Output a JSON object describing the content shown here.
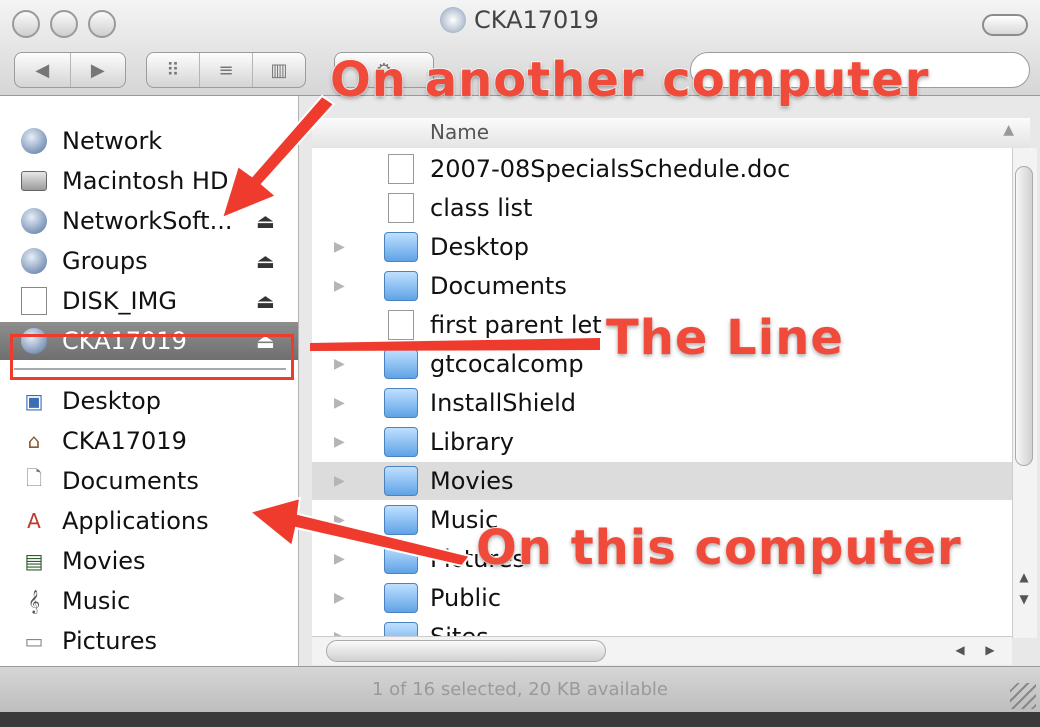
{
  "window": {
    "title": "CKA17019"
  },
  "toolbar": {
    "nav": {
      "back": "◀",
      "forward": "▶"
    },
    "views": {
      "icon": "⠿",
      "list": "≡",
      "column": "▥"
    }
  },
  "sidebar": {
    "items": [
      {
        "label": "Network",
        "icon": "network-globe-icon",
        "eject": ""
      },
      {
        "label": "Macintosh HD",
        "icon": "hard-drive-icon",
        "eject": ""
      },
      {
        "label": "NetworkSoft...",
        "icon": "network-volume-icon",
        "eject": "⏏"
      },
      {
        "label": "Groups",
        "icon": "network-volume-icon",
        "eject": "⏏"
      },
      {
        "label": "DISK_IMG",
        "icon": "disk-image-icon",
        "eject": "⏏"
      },
      {
        "label": "CKA17019",
        "icon": "network-volume-icon",
        "eject": "⏏"
      },
      {
        "label": "Desktop",
        "icon": "desktop-icon",
        "eject": ""
      },
      {
        "label": "CKA17019",
        "icon": "home-icon",
        "eject": ""
      },
      {
        "label": "Documents",
        "icon": "documents-icon",
        "eject": ""
      },
      {
        "label": "Applications",
        "icon": "applications-icon",
        "eject": ""
      },
      {
        "label": "Movies",
        "icon": "movies-icon",
        "eject": ""
      },
      {
        "label": "Music",
        "icon": "music-icon",
        "eject": ""
      },
      {
        "label": "Pictures",
        "icon": "pictures-icon",
        "eject": ""
      }
    ]
  },
  "list": {
    "column_name": "Name",
    "rows": [
      {
        "name": "2007-08SpecialsSchedule.doc",
        "kind": "doc"
      },
      {
        "name": "class list",
        "kind": "doc"
      },
      {
        "name": "Desktop",
        "kind": "folder"
      },
      {
        "name": "Documents",
        "kind": "folder"
      },
      {
        "name": "first parent let",
        "kind": "doc"
      },
      {
        "name": "gtcocalcomp",
        "kind": "folder"
      },
      {
        "name": "InstallShield",
        "kind": "folder"
      },
      {
        "name": "Library",
        "kind": "folder"
      },
      {
        "name": "Movies",
        "kind": "folder",
        "selected": true
      },
      {
        "name": "Music",
        "kind": "folder"
      },
      {
        "name": "Pictures",
        "kind": "folder"
      },
      {
        "name": "Public",
        "kind": "folder"
      },
      {
        "name": "Sites",
        "kind": "folder"
      }
    ]
  },
  "status": "1 of 16 selected, 20 KB available",
  "annotations": {
    "another_computer": "On another computer",
    "the_line": "The Line",
    "this_computer": "On this computer",
    "color": "#f04a3a"
  }
}
